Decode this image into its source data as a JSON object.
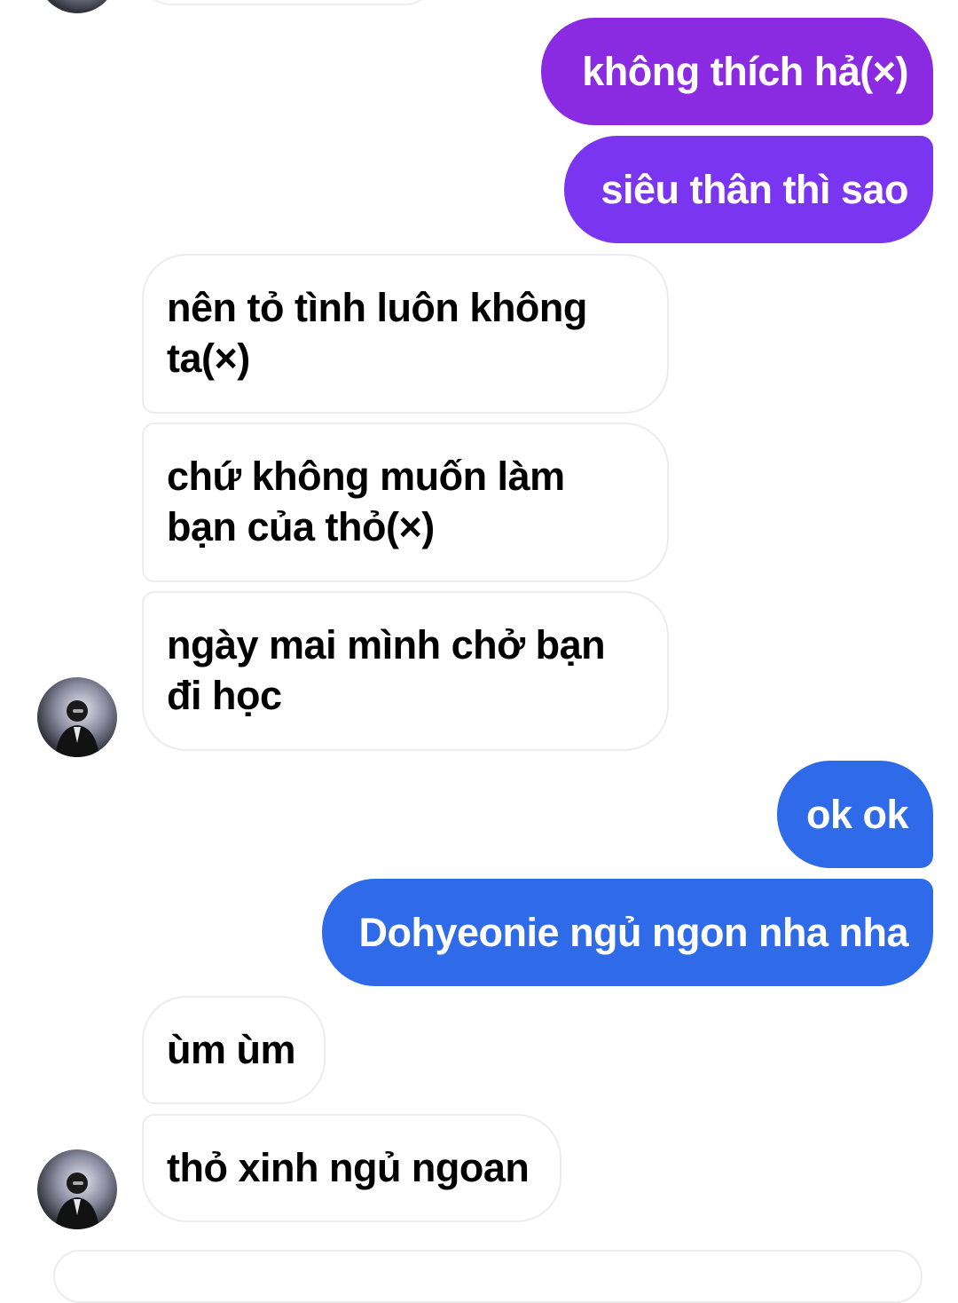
{
  "colors": {
    "sent_purple": "#8a2be2",
    "sent_violet": "#7a35f0",
    "sent_blue": "#2f6ae8",
    "received_bg": "#ffffff",
    "received_border": "#ececec"
  },
  "chat": {
    "messages": [
      {
        "from": "me",
        "text": "không thích hả(×)"
      },
      {
        "from": "me",
        "text": "siêu thân thì sao"
      },
      {
        "from": "other",
        "line1": "nên tỏ tình luôn không",
        "line2": "ta(×)"
      },
      {
        "from": "other",
        "line1": "chứ không muốn làm",
        "line2": "bạn của thỏ(×)"
      },
      {
        "from": "other",
        "line1": "ngày mai mình chở bạn",
        "line2": "đi học"
      },
      {
        "from": "me",
        "text": "ok ok"
      },
      {
        "from": "me",
        "text": "Dohyeonie ngủ ngon nha nha"
      },
      {
        "from": "other",
        "text": "ùm ùm"
      },
      {
        "from": "other",
        "text": "thỏ xinh ngủ ngoan"
      }
    ]
  }
}
